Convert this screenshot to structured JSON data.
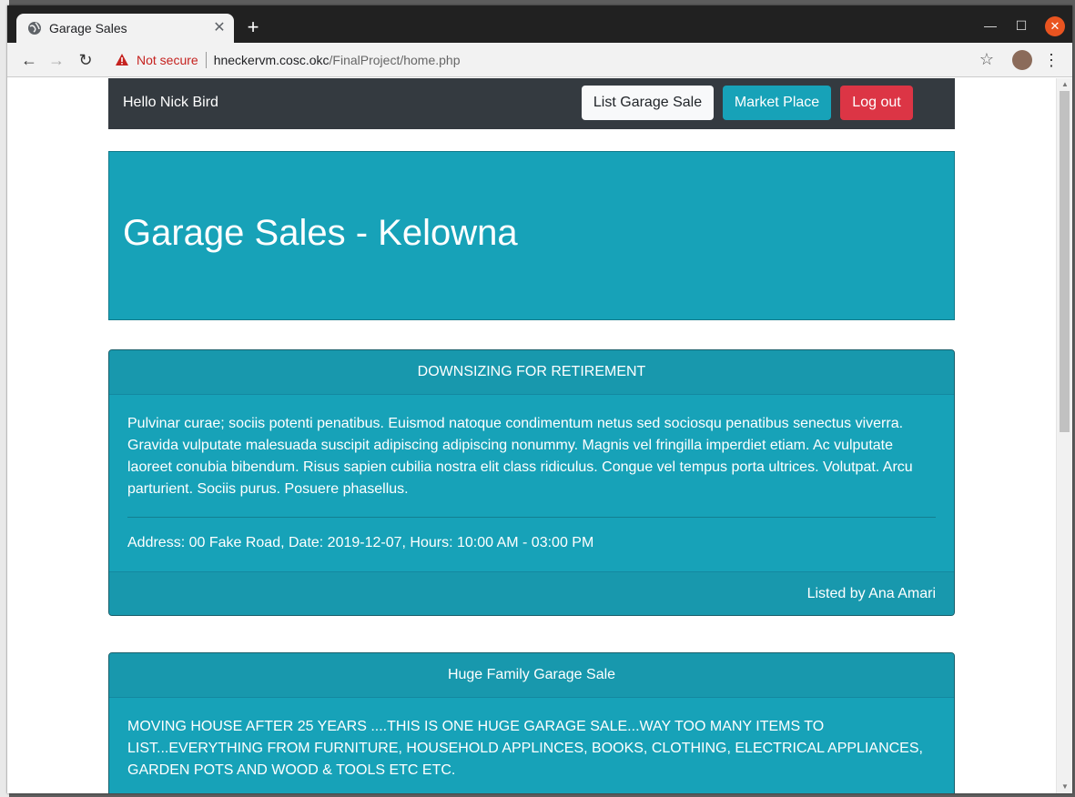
{
  "browser": {
    "tab_title": "Garage Sales",
    "security_label": "Not secure",
    "url_host": "hneckervm.cosc.okc",
    "url_path": "/FinalProject/home.php"
  },
  "navbar": {
    "greeting": "Hello Nick Bird",
    "list_btn": "List Garage Sale",
    "market_btn": "Market Place",
    "logout_btn": "Log out"
  },
  "jumbotron": {
    "title": "Garage Sales - Kelowna"
  },
  "listings": [
    {
      "title": "DOWNSIZING FOR RETIREMENT",
      "description": "Pulvinar curae; sociis potenti penatibus. Euismod natoque condimentum netus sed sociosqu penatibus senectus viverra. Gravida vulputate malesuada suscipit adipiscing adipiscing nonummy. Magnis vel fringilla imperdiet etiam. Ac vulputate laoreet conubia bibendum. Risus sapien cubilia nostra elit class ridiculus. Congue vel tempus porta ultrices. Volutpat. Arcu parturient. Sociis purus. Posuere phasellus.",
      "details": "Address: 00 Fake Road, Date: 2019-12-07, Hours: 10:00 AM - 03:00 PM",
      "listed_by": "Listed by Ana Amari"
    },
    {
      "title": "Huge Family Garage Sale",
      "description": "MOVING HOUSE AFTER 25 YEARS ....THIS IS ONE HUGE GARAGE SALE...WAY TOO MANY ITEMS TO LIST...EVERYTHING FROM FURNITURE, HOUSEHOLD APPLINCES, BOOKS, CLOTHING, ELECTRICAL APPLIANCES, GARDEN POTS AND WOOD & TOOLS ETC ETC."
    }
  ],
  "colors": {
    "navbar": "#343a40",
    "info": "#17a2b8",
    "danger": "#dc3545",
    "light": "#f8f9fa"
  }
}
